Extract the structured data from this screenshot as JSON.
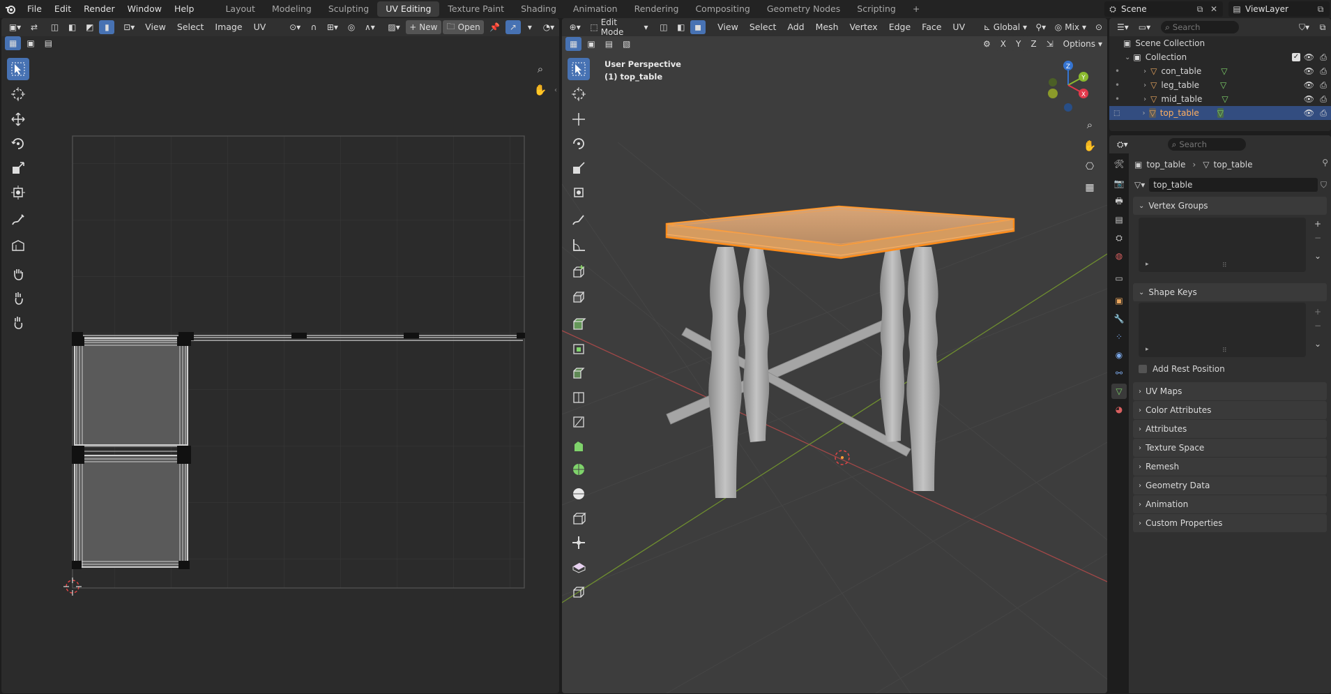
{
  "topbar": {
    "menus": [
      "File",
      "Edit",
      "Render",
      "Window",
      "Help"
    ],
    "workspaces": [
      "Layout",
      "Modeling",
      "Sculpting",
      "UV Editing",
      "Texture Paint",
      "Shading",
      "Animation",
      "Rendering",
      "Compositing",
      "Geometry Nodes",
      "Scripting"
    ],
    "active_workspace": "UV Editing",
    "add_tab": "+",
    "scene": "Scene",
    "viewlayer": "ViewLayer"
  },
  "uv_editor": {
    "menus": [
      "View",
      "Select",
      "Image",
      "UV"
    ],
    "new_label": "New",
    "open_label": "Open"
  },
  "viewport": {
    "mode": "Edit Mode",
    "menus": [
      "View",
      "Select",
      "Add",
      "Mesh",
      "Vertex",
      "Edge",
      "Face",
      "UV"
    ],
    "transform_orientation": "Global",
    "snap_label": "Mix",
    "axes": [
      "X",
      "Y",
      "Z"
    ],
    "options_label": "Options",
    "overlay_line1": "User Perspective",
    "overlay_line2": "(1) top_table",
    "gizmo": {
      "z": "Z",
      "y": "Y",
      "x": "X"
    }
  },
  "outliner": {
    "search_placeholder": "Search",
    "scene_collection": "Scene Collection",
    "collection": "Collection",
    "objects": [
      "con_table",
      "leg_table",
      "mid_table",
      "top_table"
    ],
    "selected": "top_table"
  },
  "properties": {
    "search_placeholder": "Search",
    "breadcrumb_object": "top_table",
    "breadcrumb_data": "top_table",
    "mesh_name": "top_table",
    "vertex_groups": "Vertex Groups",
    "shape_keys": "Shape Keys",
    "add_rest_position": "Add Rest Position",
    "panels": [
      "UV Maps",
      "Color Attributes",
      "Attributes",
      "Texture Space",
      "Remesh",
      "Geometry Data",
      "Animation",
      "Custom Properties"
    ]
  },
  "colors": {
    "accent": "#4772b3",
    "selection": "#ff8c1a",
    "header": "#303030",
    "background": "#1d1d1d"
  }
}
